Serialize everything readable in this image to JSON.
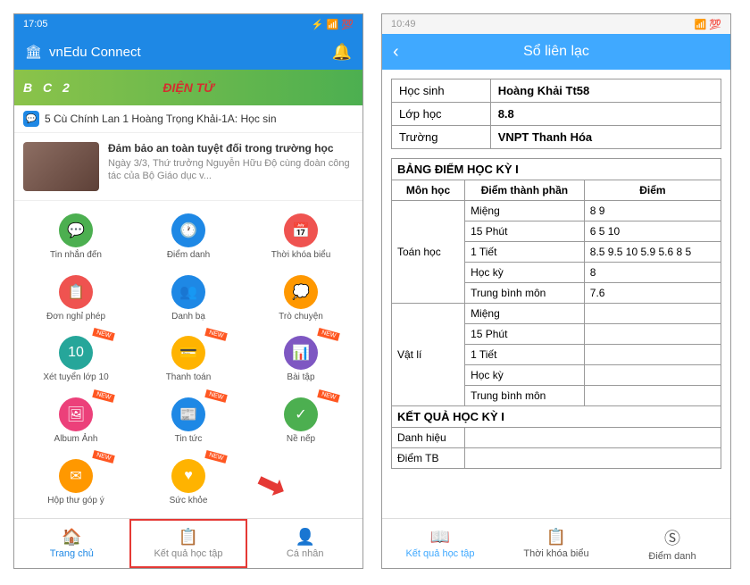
{
  "left": {
    "statusbar": {
      "time": "17:05",
      "right": "⚡ 📶 💯"
    },
    "app_title": "vnEdu Connect",
    "banner_text": "ĐIỆN TỬ",
    "ticker": "5 Cù Chính Lan 1 Hoàng Trọng Khải-1A: Học sin",
    "news": {
      "title": "Đảm bảo an toàn tuyệt đối trong trường học",
      "desc": "Ngày 3/3, Thứ trưởng Nguyễn Hữu Độ cùng đoàn công tác của Bộ Giáo dục v..."
    },
    "grid": [
      {
        "label": "Tin nhắn đến",
        "color": "c-green",
        "icon": "💬",
        "new": false
      },
      {
        "label": "Điểm danh",
        "color": "c-blue",
        "icon": "🕐",
        "new": false
      },
      {
        "label": "Thời khóa biểu",
        "color": "c-red",
        "icon": "📅",
        "new": false
      },
      {
        "label": "Đơn nghỉ phép",
        "color": "c-red",
        "icon": "📋",
        "new": false
      },
      {
        "label": "Danh bạ",
        "color": "c-blue",
        "icon": "👥",
        "new": false
      },
      {
        "label": "Trò chuyện",
        "color": "c-orange",
        "icon": "💭",
        "new": false
      },
      {
        "label": "Xét tuyển lớp 10",
        "color": "c-teal",
        "icon": "10",
        "new": true
      },
      {
        "label": "Thanh toán",
        "color": "c-amber",
        "icon": "💳",
        "new": true
      },
      {
        "label": "Bài tập",
        "color": "c-purple",
        "icon": "📊",
        "new": true
      },
      {
        "label": "Album Ảnh",
        "color": "c-pink",
        "icon": "🖼",
        "new": true
      },
      {
        "label": "Tin tức",
        "color": "c-blue",
        "icon": "📰",
        "new": true
      },
      {
        "label": "Nề nếp",
        "color": "c-green",
        "icon": "✓",
        "new": true
      },
      {
        "label": "Hộp thư góp ý",
        "color": "c-orange",
        "icon": "✉",
        "new": true
      },
      {
        "label": "Sức khỏe",
        "color": "c-amber",
        "icon": "♥",
        "new": true
      },
      {
        "label": "",
        "color": "",
        "icon": "",
        "new": false
      }
    ],
    "nav": [
      {
        "label": "Trang chủ",
        "icon": "🏠"
      },
      {
        "label": "Kết quả học tập",
        "icon": "📋"
      },
      {
        "label": "Cá nhân",
        "icon": "👤"
      }
    ]
  },
  "right": {
    "statusbar": {
      "time": "10:49",
      "right": "📶 💯"
    },
    "title": "Sổ liên lạc",
    "info": [
      {
        "k": "Học sinh",
        "v": "Hoàng Khải Tt58"
      },
      {
        "k": "Lớp học",
        "v": "8.8"
      },
      {
        "k": "Trường",
        "v": "VNPT Thanh Hóa"
      }
    ],
    "section1": "BẢNG ĐIỂM HỌC KỲ I",
    "headers": {
      "h1": "Môn học",
      "h2": "Điểm thành phần",
      "h3": "Điểm"
    },
    "subjects": [
      {
        "name": "Toán học",
        "rows": [
          {
            "k": "Miệng",
            "v": "8  9"
          },
          {
            "k": "15 Phút",
            "v": "6  5  10"
          },
          {
            "k": "1 Tiết",
            "v": "8.5  9.5  10  5.9  5.6  8  5"
          },
          {
            "k": "Học kỳ",
            "v": "8"
          },
          {
            "k": "Trung bình môn",
            "v": "7.6"
          }
        ]
      },
      {
        "name": "Vật lí",
        "rows": [
          {
            "k": "Miệng",
            "v": ""
          },
          {
            "k": "15 Phút",
            "v": ""
          },
          {
            "k": "1 Tiết",
            "v": ""
          },
          {
            "k": "Học kỳ",
            "v": ""
          },
          {
            "k": "Trung bình môn",
            "v": ""
          }
        ]
      }
    ],
    "section2": "KẾT QUẢ HỌC KỲ I",
    "result_rows": [
      {
        "k": "Danh hiệu",
        "v": ""
      },
      {
        "k": "Điểm TB",
        "v": ""
      }
    ],
    "nav": [
      {
        "label": "Kết quả học tập",
        "icon": "📖"
      },
      {
        "label": "Thời khóa biểu",
        "icon": "📋"
      },
      {
        "label": "Điểm danh",
        "icon": "Ⓢ"
      }
    ]
  }
}
